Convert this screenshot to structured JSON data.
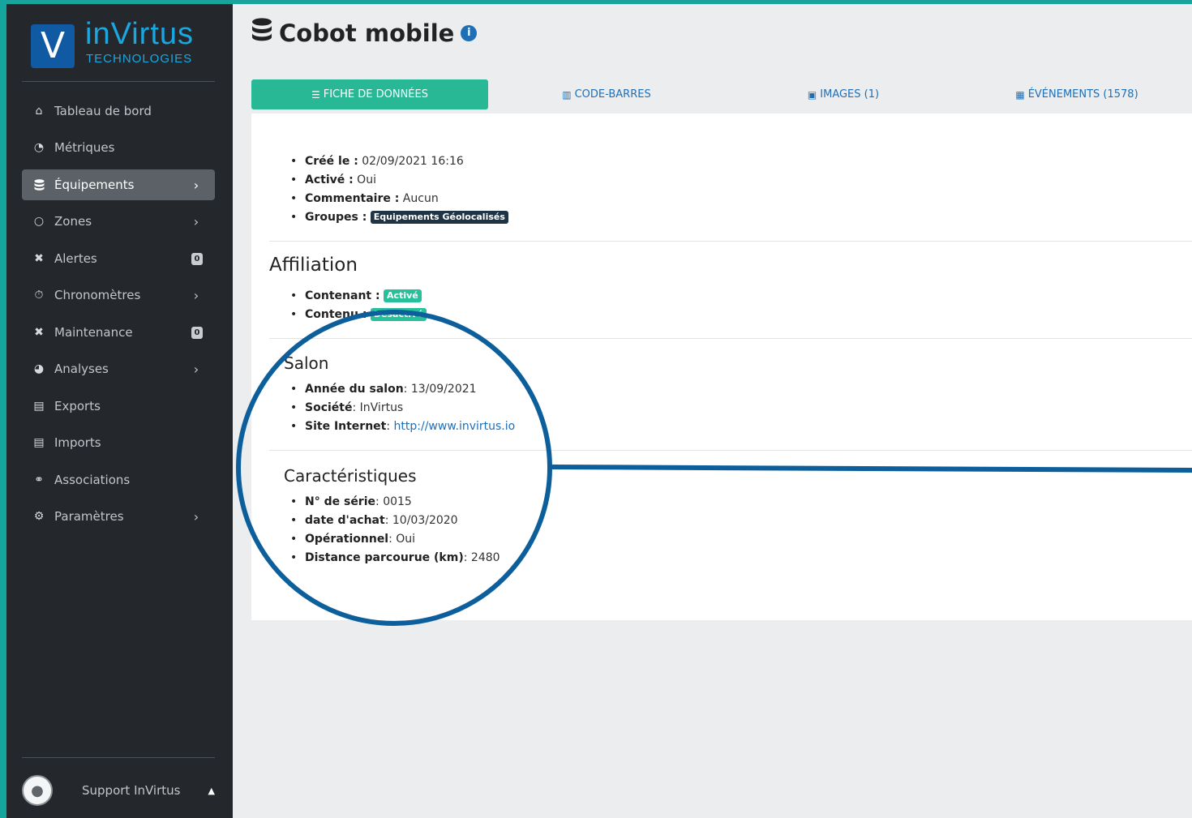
{
  "brand": {
    "logo_letter": "V",
    "name": "inVirtus",
    "subtitle": "TECHNOLOGIES"
  },
  "sidebar": {
    "items": [
      {
        "label": "Tableau de bord",
        "icon": "home-icon",
        "chevron": false,
        "count": null
      },
      {
        "label": "Métriques",
        "icon": "tachometer-icon",
        "chevron": false,
        "count": null
      },
      {
        "label": "Équipements",
        "icon": "database-icon",
        "chevron": true,
        "count": null,
        "active": true
      },
      {
        "label": "Zones",
        "icon": "circle-icon",
        "chevron": true,
        "count": null
      },
      {
        "label": "Alertes",
        "icon": "tools-icon",
        "chevron": false,
        "count": "0"
      },
      {
        "label": "Chronomètres",
        "icon": "stopwatch-icon",
        "chevron": true,
        "count": null
      },
      {
        "label": "Maintenance",
        "icon": "tools-icon",
        "chevron": false,
        "count": "0"
      },
      {
        "label": "Analyses",
        "icon": "pie-chart-icon",
        "chevron": true,
        "count": null
      },
      {
        "label": "Exports",
        "icon": "file-export-icon",
        "chevron": false,
        "count": null
      },
      {
        "label": "Imports",
        "icon": "file-import-icon",
        "chevron": false,
        "count": null
      },
      {
        "label": "Associations",
        "icon": "link-icon",
        "chevron": false,
        "count": null
      },
      {
        "label": "Paramètres",
        "icon": "cogs-icon",
        "chevron": true,
        "count": null
      }
    ],
    "user": {
      "label": "Support InVirtus"
    }
  },
  "page": {
    "title": "Cobot mobile"
  },
  "tabs": [
    {
      "label": "FICHE DE DONNÉES",
      "icon": "database-icon",
      "active": true
    },
    {
      "label": "CODE-BARRES",
      "icon": "barcode-icon",
      "active": false
    },
    {
      "label": "IMAGES (1)",
      "icon": "images-icon",
      "active": false
    },
    {
      "label": "ÉVÉNEMENTS (1578)",
      "icon": "calendar-icon",
      "active": false
    }
  ],
  "general": {
    "created_label": "Créé le :",
    "created_value": "02/09/2021 16:16",
    "active_label": "Activé :",
    "active_value": "Oui",
    "comment_label": "Commentaire :",
    "comment_value": "Aucun",
    "groups_label": "Groupes :",
    "groups_badge": "Equipements Géolocalisés"
  },
  "affiliation": {
    "title": "Affiliation",
    "container_label": "Contenant :",
    "container_badge": "Activé",
    "content_label": "Contenu :",
    "content_badge": "Désactivé"
  },
  "salon": {
    "title": "Salon",
    "year_label": "Année du salon",
    "year_value": "13/09/2021",
    "company_label": "Société",
    "company_value": "InVirtus",
    "website_label": "Site Internet",
    "website_value": "http://www.invirtus.io"
  },
  "specs": {
    "title": "Caractéristiques",
    "serial_label": "N° de série",
    "serial_value": "0015",
    "purchase_label": "date d'achat",
    "purchase_value": "10/03/2020",
    "operational_label": "Opérationnel",
    "operational_value": "Oui",
    "distance_label": "Distance parcourue (km)",
    "distance_value": "2480"
  },
  "colors": {
    "accent": "#28b895",
    "brand_blue": "#1f6fb6",
    "callout": "#0d5f9c",
    "sidebar": "#24282c"
  }
}
